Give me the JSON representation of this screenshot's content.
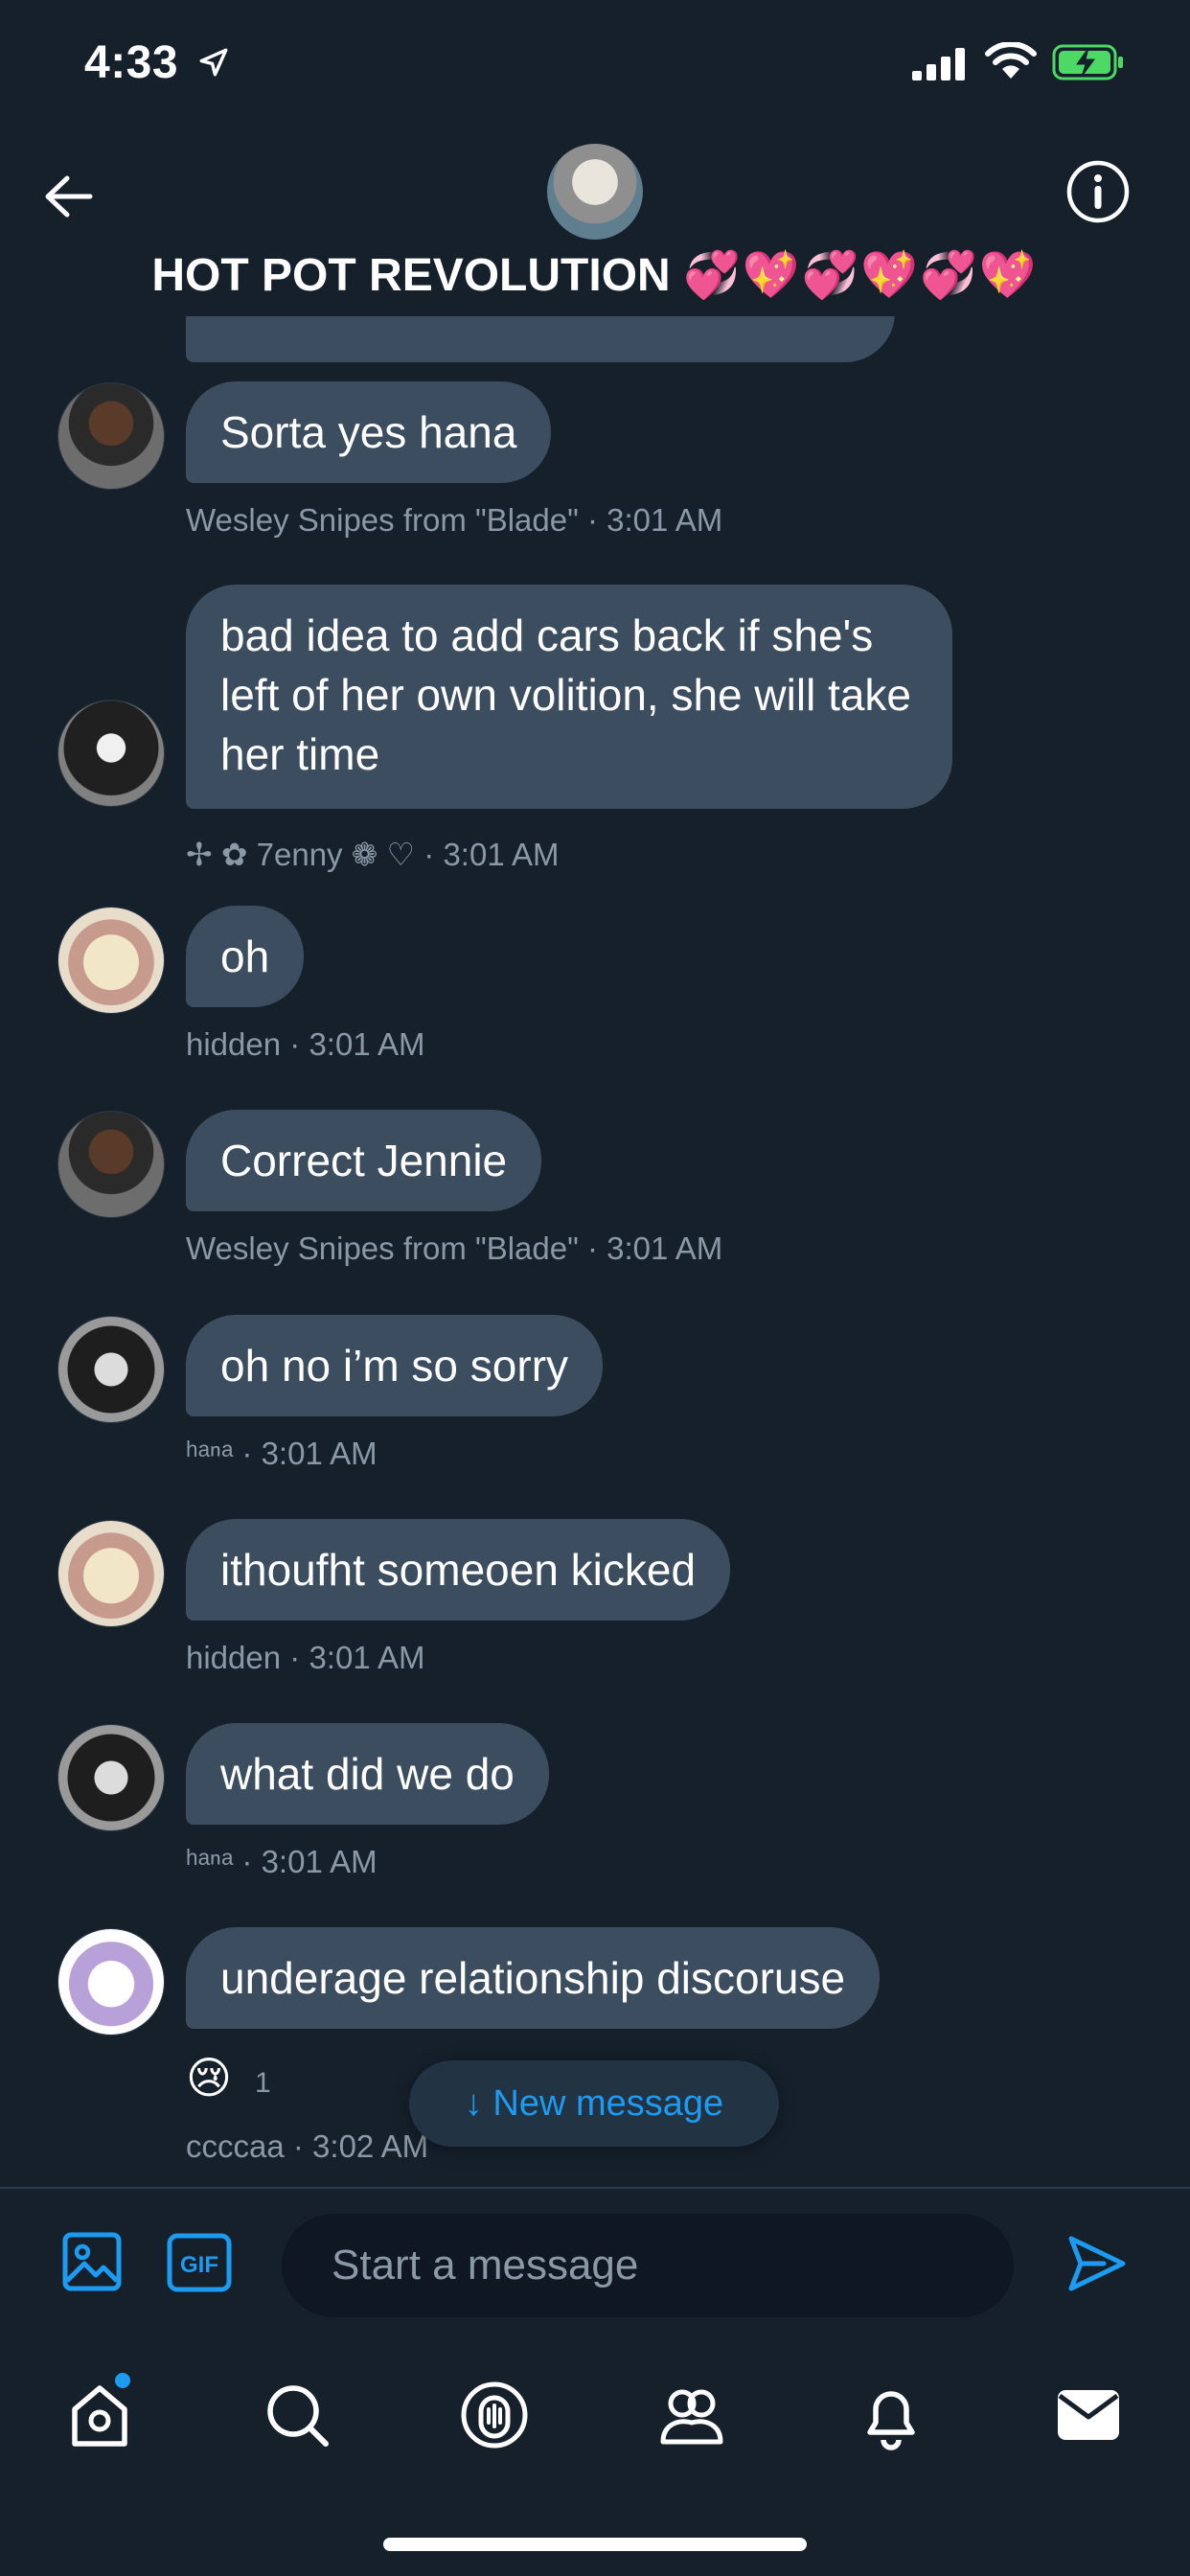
{
  "status_bar": {
    "time": "4:33"
  },
  "header": {
    "title": "HOT POT REVOLUTION",
    "title_emoji": "💞💖💞💖💞💖"
  },
  "thread": {
    "messages": [
      {
        "text": "Sorta yes hana",
        "sender": "Wesley Snipes from \"Blade\"",
        "time": "· 3:01 AM"
      },
      {
        "text": "bad idea to add cars back if she's left of her own volition, she will take her time",
        "sender": "✢ ✿ 7enny ❁ ♡",
        "time": "· 3:01 AM"
      },
      {
        "text": "oh",
        "sender": "hidden",
        "time": "· 3:01 AM"
      },
      {
        "text": "Correct Jennie",
        "sender": "Wesley Snipes from \"Blade\"",
        "time": "· 3:01 AM"
      },
      {
        "text": "oh no i’m so sorry",
        "sender": "ʰᵃⁿᵃ",
        "time": "· 3:01 AM"
      },
      {
        "text": "ithoufht someoen kicked",
        "sender": "hidden",
        "time": "· 3:01 AM"
      },
      {
        "text": "what did we do",
        "sender": "ʰᵃⁿᵃ",
        "time": "· 3:01 AM"
      },
      {
        "text": "underage relationship discoruse",
        "sender": "ccccaa",
        "time": "· 3:02 AM",
        "reaction": {
          "emoji": "😢",
          "count": "1"
        }
      }
    ]
  },
  "new_message_pill": {
    "label": "↓ New message"
  },
  "composer": {
    "placeholder": "Start a message",
    "gif_label": "GIF"
  },
  "colors": {
    "accent": "#1d9bf0",
    "bubble": "#3c4d5f",
    "background": "#15202b",
    "meta": "#8b98a5"
  },
  "tabs": [
    "home-icon",
    "search-icon",
    "spaces-icon",
    "communities-icon",
    "notifications-icon",
    "messages-icon"
  ]
}
